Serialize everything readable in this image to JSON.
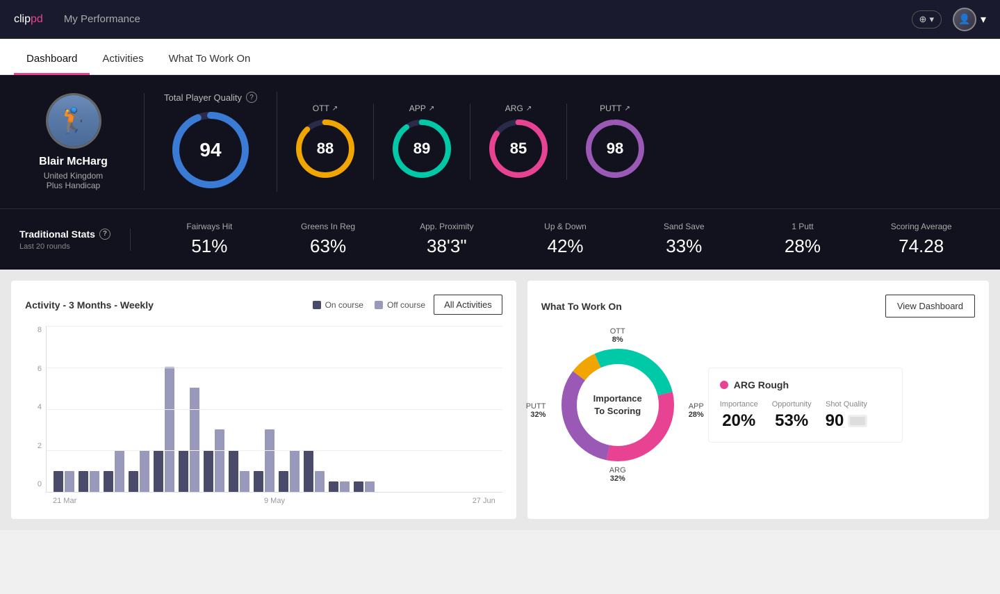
{
  "header": {
    "logo_clip": "clip",
    "logo_pd": "pd",
    "title": "My Performance",
    "add_label": "+",
    "chevron": "▾"
  },
  "nav": {
    "tabs": [
      {
        "id": "dashboard",
        "label": "Dashboard",
        "active": true
      },
      {
        "id": "activities",
        "label": "Activities",
        "active": false
      },
      {
        "id": "what-to-work-on",
        "label": "What To Work On",
        "active": false
      }
    ]
  },
  "player": {
    "name": "Blair McHarg",
    "country": "United Kingdom",
    "handicap": "Plus Handicap",
    "avatar_emoji": "🏌️"
  },
  "quality": {
    "label": "Total Player Quality",
    "total": {
      "value": 94,
      "color": "#3a7bd5"
    },
    "ott": {
      "label": "OTT",
      "value": 88,
      "color": "#f0a500"
    },
    "app": {
      "label": "APP",
      "value": 89,
      "color": "#00c9a7"
    },
    "arg": {
      "label": "ARG",
      "value": 85,
      "color": "#e84393"
    },
    "putt": {
      "label": "PUTT",
      "value": 98,
      "color": "#9b59b6"
    }
  },
  "trad_stats": {
    "label": "Traditional Stats",
    "sub": "Last 20 rounds",
    "items": [
      {
        "name": "Fairways Hit",
        "value": "51%"
      },
      {
        "name": "Greens In Reg",
        "value": "63%"
      },
      {
        "name": "App. Proximity",
        "value": "38'3\""
      },
      {
        "name": "Up & Down",
        "value": "42%"
      },
      {
        "name": "Sand Save",
        "value": "33%"
      },
      {
        "name": "1 Putt",
        "value": "28%"
      },
      {
        "name": "Scoring Average",
        "value": "74.28"
      }
    ]
  },
  "activity_chart": {
    "title": "Activity - 3 Months - Weekly",
    "legend": {
      "on_course": "On course",
      "off_course": "Off course"
    },
    "all_activities_btn": "All Activities",
    "y_labels": [
      "8",
      "6",
      "4",
      "2",
      "0"
    ],
    "x_labels": [
      "21 Mar",
      "9 May",
      "27 Jun"
    ],
    "bars": [
      {
        "on": 1,
        "off": 1
      },
      {
        "on": 1,
        "off": 1
      },
      {
        "on": 1,
        "off": 2
      },
      {
        "on": 1,
        "off": 2
      },
      {
        "on": 2,
        "off": 6
      },
      {
        "on": 2,
        "off": 5
      },
      {
        "on": 2,
        "off": 3
      },
      {
        "on": 2,
        "off": 1
      },
      {
        "on": 1,
        "off": 3
      },
      {
        "on": 1,
        "off": 2
      },
      {
        "on": 2,
        "off": 1
      },
      {
        "on": 1,
        "off": 0.5
      },
      {
        "on": 0.5,
        "off": 0.5
      }
    ],
    "colors": {
      "on_course": "#4a4a6a",
      "off_course": "#9999bb"
    }
  },
  "what_to_work_on": {
    "title": "What To Work On",
    "view_dashboard_btn": "View Dashboard",
    "donut_center": "Importance\nTo Scoring",
    "segments": [
      {
        "label": "OTT",
        "pct": "8%",
        "value": 8,
        "color": "#f0a500"
      },
      {
        "label": "APP",
        "pct": "28%",
        "value": 28,
        "color": "#00c9a7"
      },
      {
        "label": "ARG",
        "pct": "32%",
        "value": 32,
        "color": "#e84393"
      },
      {
        "label": "PUTT",
        "pct": "32%",
        "value": 32,
        "color": "#9b59b6"
      }
    ],
    "card": {
      "title": "ARG Rough",
      "dot_color": "#e84393",
      "metrics": [
        {
          "label": "Importance",
          "value": "20%"
        },
        {
          "label": "Opportunity",
          "value": "53%"
        },
        {
          "label": "Shot Quality",
          "value": "90"
        }
      ]
    }
  },
  "colors": {
    "header_bg": "#1a1a2e",
    "banner_bg": "#12121f",
    "accent": "#e84393"
  }
}
